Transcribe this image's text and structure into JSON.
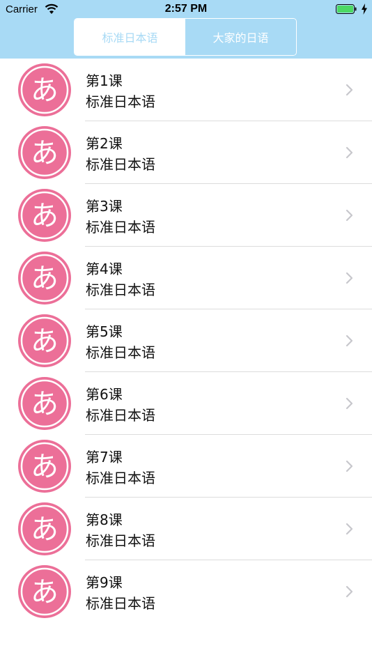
{
  "status_bar": {
    "carrier": "Carrier",
    "time": "2:57 PM"
  },
  "segmented_control": {
    "selected": "标准日本语",
    "other": "大家的日语"
  },
  "colors": {
    "header_bg": "#a8daf5",
    "avatar_pink": "#ec6f98",
    "separator": "#dcdcdc"
  },
  "icons": {
    "avatar": "hiragana-a-icon",
    "row_accessory": "chevron-right-icon"
  },
  "avatar_glyph": "あ",
  "lessons": [
    {
      "title": "第1课",
      "subtitle": "标准日本语"
    },
    {
      "title": "第2课",
      "subtitle": "标准日本语"
    },
    {
      "title": "第3课",
      "subtitle": "标准日本语"
    },
    {
      "title": "第4课",
      "subtitle": "标准日本语"
    },
    {
      "title": "第5课",
      "subtitle": "标准日本语"
    },
    {
      "title": "第6课",
      "subtitle": "标准日本语"
    },
    {
      "title": "第7课",
      "subtitle": "标准日本语"
    },
    {
      "title": "第8课",
      "subtitle": "标准日本语"
    },
    {
      "title": "第9课",
      "subtitle": "标准日本语"
    }
  ]
}
